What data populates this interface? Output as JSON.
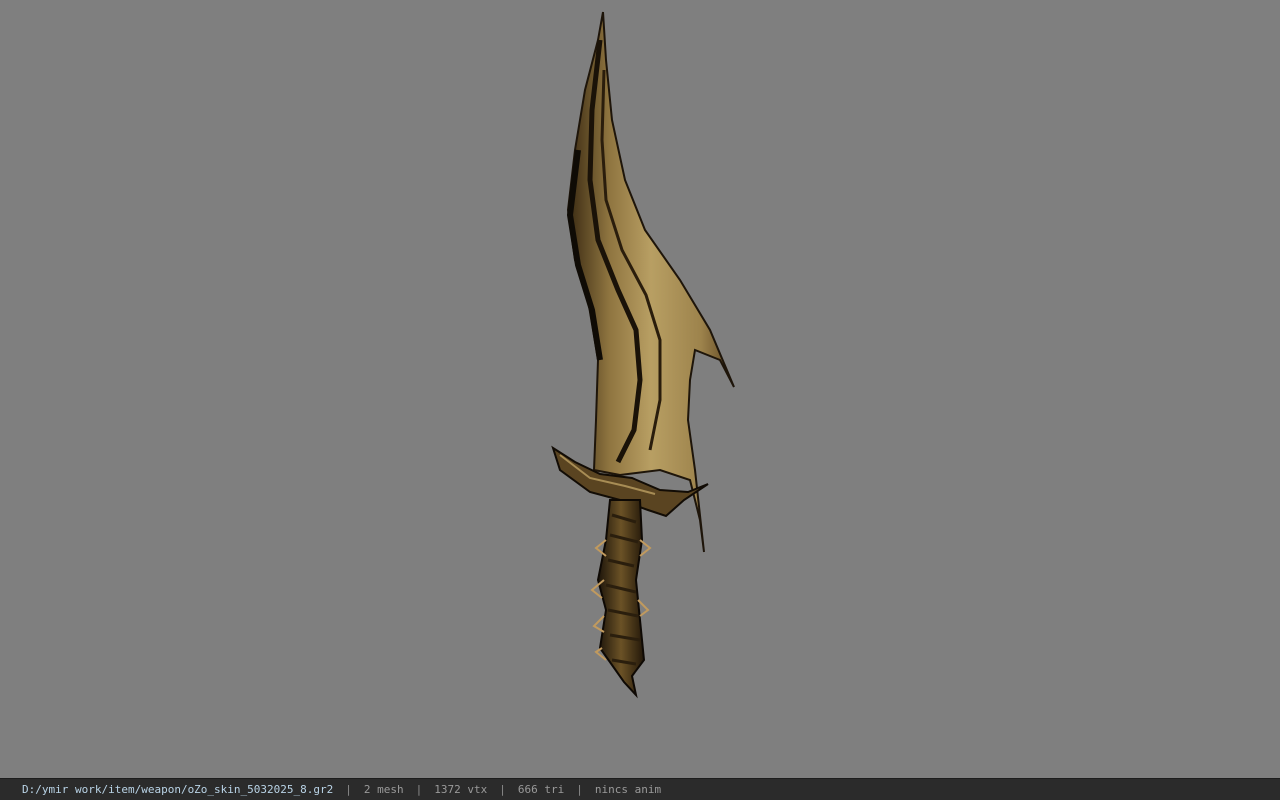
{
  "viewport": {
    "background": "#7f7f7f",
    "model": "sword-model"
  },
  "status_bar": {
    "file_path": "D:/ymir work/item/weapon/oZo_skin_5032025_8.gr2",
    "separator": "|",
    "mesh_count": "2 mesh",
    "vertex_count": "1372 vtx",
    "triangle_count": "666 tri",
    "animation": "nincs anim"
  }
}
